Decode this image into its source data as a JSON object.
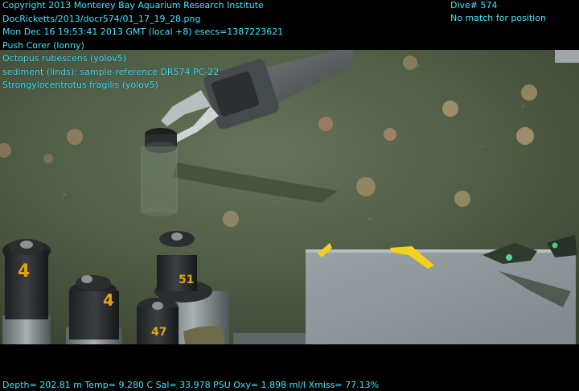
{
  "overlay": {
    "top_left": [
      "Copyright 2013 Monterey Bay Aquarium Research Institute",
      "DocRicketts/2013/docr574/01_17_19_28.png",
      "Mon Dec 16 19:53:41 2013 GMT (local +8)  esecs=1387223621",
      "Push Corer (lonny)",
      "Octopus rubescens (yolov5)",
      "sediment (linds): sample-reference DR574 PC-22",
      "Strongylocentrotus fragilis (yolov5)"
    ],
    "top_right": [
      "Dive# 574",
      "No match for position"
    ],
    "bottom": "Depth= 202.81 m  Temp= 9.280 C  Sal= 33.978 PSU  Oxy= 1.898 ml/l  Xmiss= 77.13%"
  },
  "tube_labels": [
    "4",
    "4",
    "51",
    "47"
  ],
  "colors": {
    "overlay_text": "#3fe6ff",
    "seafloor": "#4a5640",
    "tray": "#8f979c",
    "tube_tag": "#e0a21a",
    "debris": "#f2d21c"
  },
  "icons": [
    "manipulator-arm-icon",
    "push-core-tube-icon",
    "sea-urchin-icon",
    "sample-tray-icon"
  ]
}
